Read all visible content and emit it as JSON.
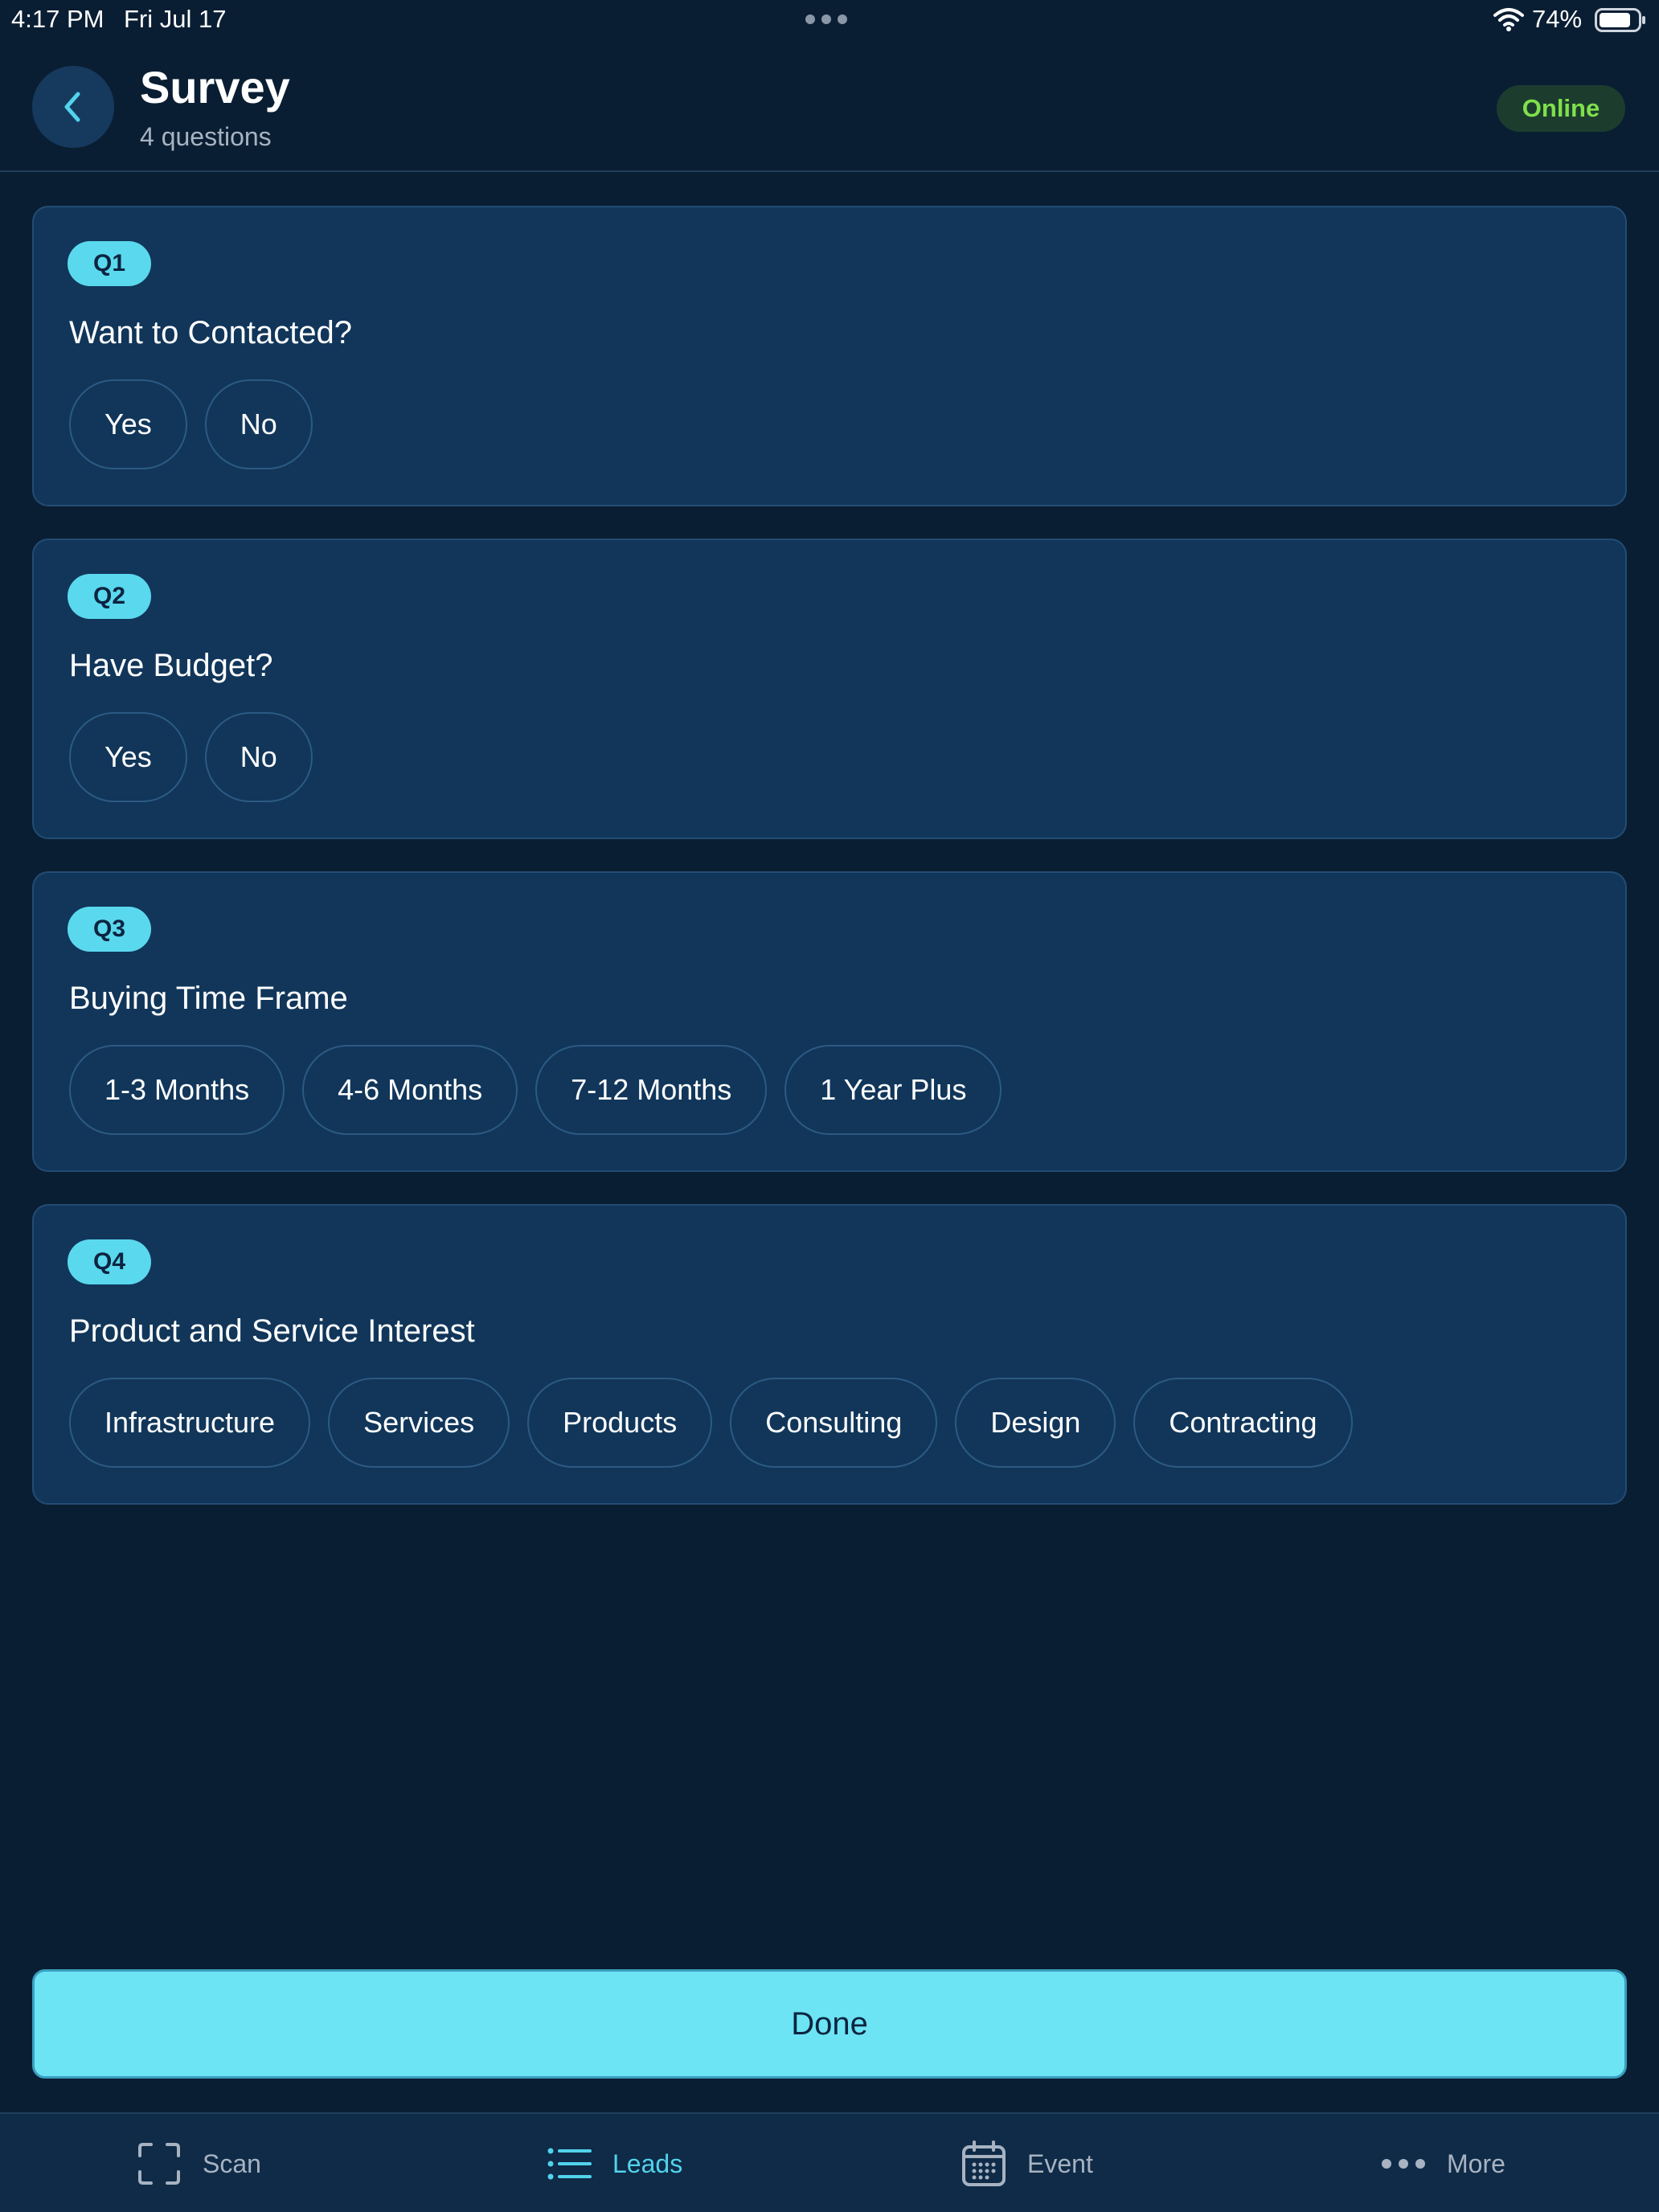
{
  "status_bar": {
    "time": "4:17 PM",
    "date": "Fri Jul 17",
    "battery": "74%",
    "icons": [
      "wifi-icon",
      "battery-icon",
      "multitasking-dots-icon"
    ]
  },
  "header": {
    "title": "Survey",
    "subtitle": "4 questions",
    "status_badge": "Online",
    "back_icon": "chevron-left-icon"
  },
  "questions": [
    {
      "badge": "Q1",
      "text": "Want to Contacted?",
      "options": [
        "Yes",
        "No"
      ]
    },
    {
      "badge": "Q2",
      "text": "Have Budget?",
      "options": [
        "Yes",
        "No"
      ]
    },
    {
      "badge": "Q3",
      "text": "Buying Time Frame",
      "options": [
        "1-3 Months",
        "4-6 Months",
        "7-12 Months",
        "1 Year Plus"
      ]
    },
    {
      "badge": "Q4",
      "text": "Product and Service Interest",
      "options": [
        "Infrastructure",
        "Services",
        "Products",
        "Consulting",
        "Design",
        "Contracting"
      ]
    }
  ],
  "done_label": "Done",
  "tab_bar": {
    "tabs": [
      {
        "label": "Scan",
        "icon": "scan-icon",
        "active": false
      },
      {
        "label": "Leads",
        "icon": "list-icon",
        "active": true
      },
      {
        "label": "Event",
        "icon": "calendar-icon",
        "active": false
      },
      {
        "label": "More",
        "icon": "more-dots-icon",
        "active": false
      }
    ]
  },
  "colors": {
    "background": "#0a1e33",
    "card": "#11365a",
    "accent": "#52d3ec",
    "done_button": "#6de4f4",
    "online_text": "#7fe04c"
  }
}
